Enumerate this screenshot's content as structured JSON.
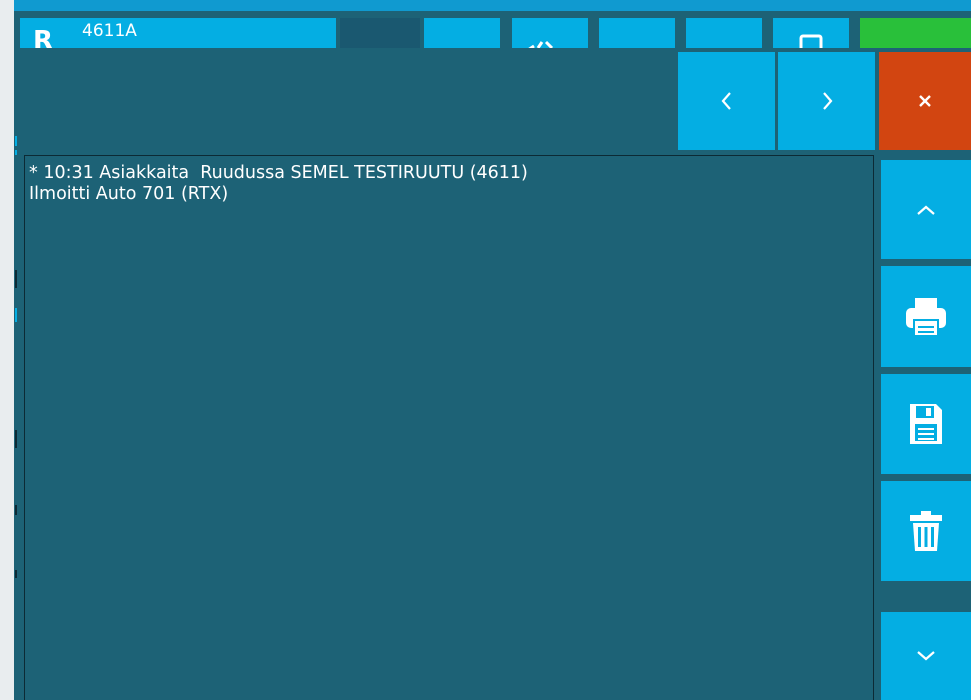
{
  "header": {
    "item_code": "4611A",
    "item_letter": "R"
  },
  "nav": {
    "prev_icon": "chevron-left-icon",
    "next_icon": "chevron-right-icon",
    "close_icon": "close-icon"
  },
  "side": {
    "scroll_up_icon": "chevron-up-icon",
    "print_icon": "printer-icon",
    "save_icon": "floppy-disk-icon",
    "delete_icon": "trash-icon",
    "scroll_down_icon": "chevron-down-icon"
  },
  "log": {
    "lines": [
      "* 10:31 Asiakkaita  Ruudussa SEMEL TESTIRUUTU (4611)",
      "Ilmoitti Auto 701 (RTX)"
    ]
  },
  "colors": {
    "panel": "#1d6276",
    "button": "#04aee3",
    "close": "#d24511",
    "status": "#29c03a",
    "top_frame": "#109ad0"
  }
}
